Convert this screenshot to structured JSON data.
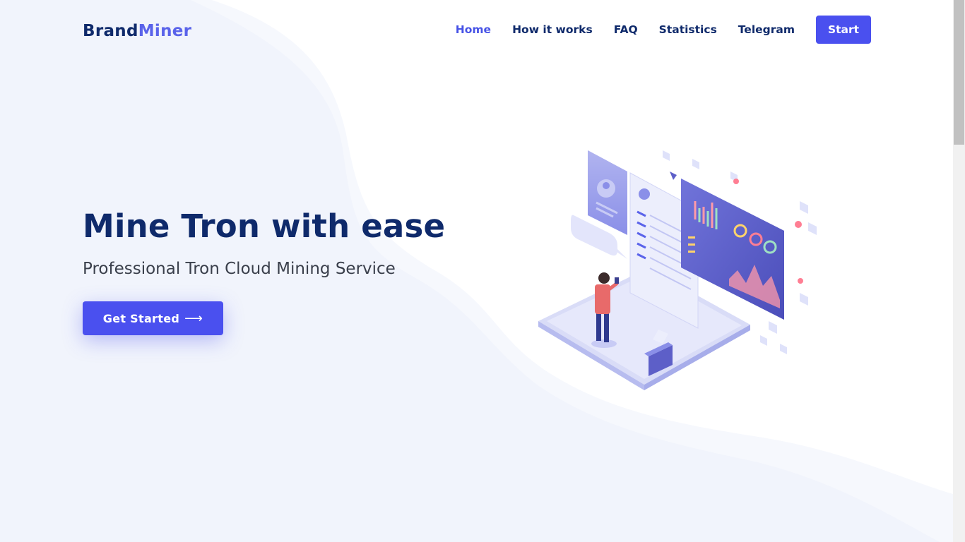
{
  "header": {
    "brand_part1": "Brand",
    "brand_part2": "Miner",
    "nav": {
      "home": "Home",
      "how_it_works": "How it works",
      "faq": "FAQ",
      "statistics": "Statistics",
      "telegram": "Telegram"
    },
    "start_label": "Start"
  },
  "hero": {
    "title": "Mine Tron with ease",
    "subtitle": "Professional Tron Cloud Mining Service",
    "cta_label": "Get Started",
    "cta_icon": "arrow-right-icon"
  },
  "colors": {
    "primary": "#4a50ef",
    "brand_dark": "#0f2a6b",
    "brand_accent": "#5a63ea",
    "background_wave": "#f1f4fc"
  },
  "illustration": {
    "icon": "isometric-dashboard-illustration"
  }
}
